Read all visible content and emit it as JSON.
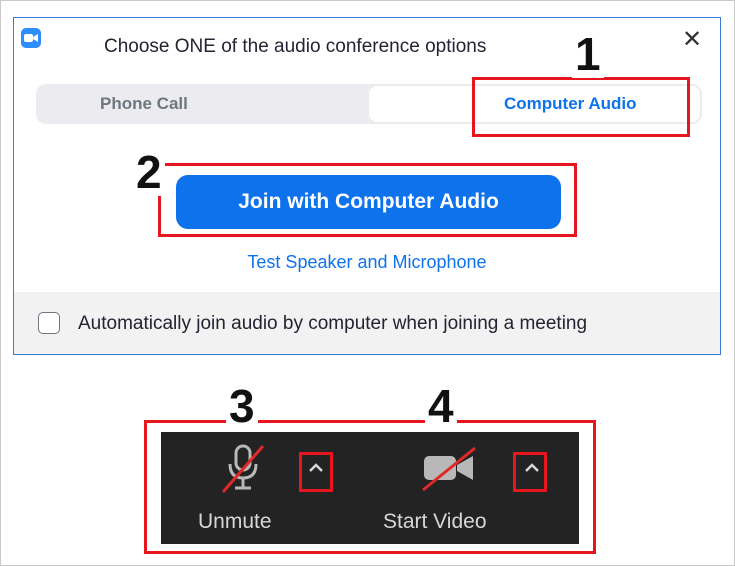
{
  "dialog": {
    "title": "Choose ONE of the audio conference options",
    "close_label": "✕",
    "tabs": [
      {
        "label": "Phone Call",
        "active": false
      },
      {
        "label": "Computer Audio",
        "active": true
      }
    ],
    "join_button": "Join with Computer Audio",
    "test_link": "Test Speaker and Microphone",
    "auto_join_checkbox": {
      "label": "Automatically join audio by computer when joining a meeting",
      "checked": false
    }
  },
  "toolbar": {
    "unmute_label": "Unmute",
    "start_video_label": "Start Video",
    "unmute_icon": "microphone-muted-icon",
    "video_icon": "video-camera-off-icon"
  },
  "callouts": {
    "one": "1",
    "two": "2",
    "three": "3",
    "four": "4"
  },
  "colors": {
    "accent": "#0e72ed",
    "highlight": "#e8141e",
    "toolbar_bg": "#232323"
  }
}
